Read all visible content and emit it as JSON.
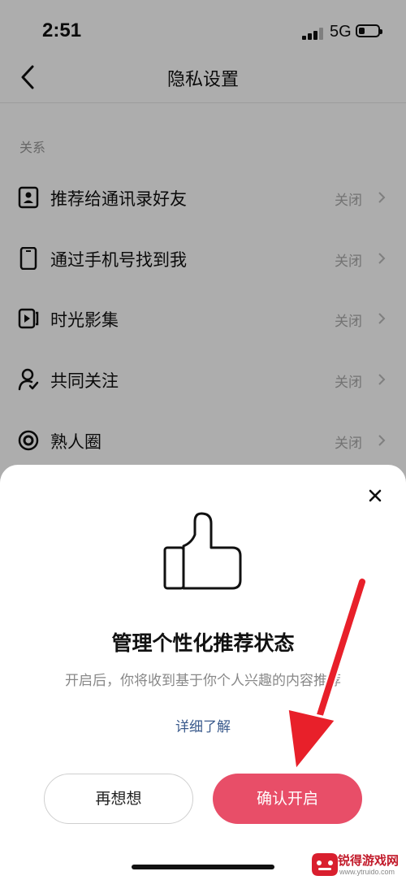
{
  "status_bar": {
    "time": "2:51",
    "network": "5G"
  },
  "nav": {
    "title": "隐私设置"
  },
  "section_label": "关系",
  "rows": [
    {
      "label": "推荐给通讯录好友",
      "value": "关闭",
      "icon": "contact-card-icon"
    },
    {
      "label": "通过手机号找到我",
      "value": "关闭",
      "icon": "phone-icon"
    },
    {
      "label": "时光影集",
      "value": "关闭",
      "icon": "video-album-icon"
    },
    {
      "label": "共同关注",
      "value": "关闭",
      "icon": "user-check-icon"
    },
    {
      "label": "熟人圈",
      "value": "关闭",
      "icon": "circle-target-icon"
    }
  ],
  "sheet": {
    "title": "管理个性化推荐状态",
    "description": "开启后，你将收到基于你个人兴趣的内容推荐",
    "learn_more": "详细了解",
    "secondary_button": "再想想",
    "primary_button": "确认开启"
  },
  "watermark": {
    "brand": "锐得游戏网",
    "url": "www.ytruido.com"
  },
  "colors": {
    "primary": "#e84e68",
    "link": "#3a5a8c",
    "annotation_arrow": "#e8202a"
  }
}
